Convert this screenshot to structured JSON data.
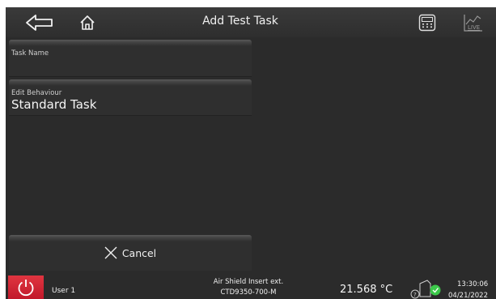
{
  "header": {
    "title": "Add Test Task",
    "back_icon": "back-arrow-icon",
    "home_icon": "home-icon",
    "calculator_icon": "calculator-icon",
    "live_icon": "live-chart-icon",
    "live_label": "LIVE"
  },
  "form": {
    "task_name": {
      "label": "Task Name",
      "value": ""
    },
    "edit_behaviour": {
      "label": "Edit Behaviour",
      "value": "Standard Task"
    }
  },
  "cancel": {
    "label": "Cancel",
    "icon": "close-icon"
  },
  "status": {
    "user": "User 1",
    "sensor_name": "Air Shield Insert ext.",
    "sensor_id": "CTD9350-700-M",
    "temperature": "21.568 °C",
    "time": "13:30:06",
    "date": "04/21/2022",
    "power_color": "#d8202f",
    "ok_color": "#3cc94a"
  }
}
